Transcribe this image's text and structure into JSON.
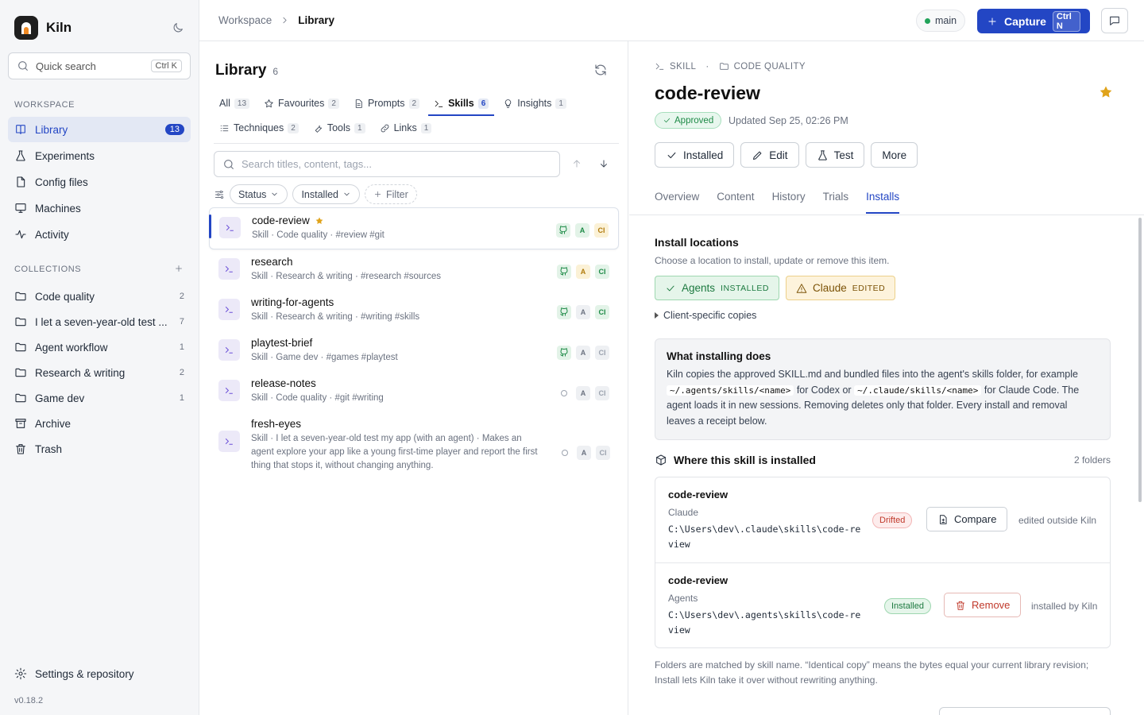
{
  "app": {
    "name": "Kiln",
    "version": "v0.18.2"
  },
  "search": {
    "label": "Quick search",
    "shortcut": "Ctrl K"
  },
  "sidebar": {
    "workspace_heading": "WORKSPACE",
    "nav": [
      {
        "label": "Library",
        "count": "13",
        "icon": "library-icon"
      },
      {
        "label": "Experiments",
        "count": "",
        "icon": "flask-icon"
      },
      {
        "label": "Config files",
        "count": "",
        "icon": "file-icon"
      },
      {
        "label": "Machines",
        "count": "",
        "icon": "monitor-icon"
      },
      {
        "label": "Activity",
        "count": "",
        "icon": "activity-icon"
      }
    ],
    "collections_heading": "COLLECTIONS",
    "collections": [
      {
        "label": "Code quality",
        "count": "2"
      },
      {
        "label": "I let a seven-year-old test ...",
        "count": "7"
      },
      {
        "label": "Agent workflow",
        "count": "1"
      },
      {
        "label": "Research & writing",
        "count": "2"
      },
      {
        "label": "Game dev",
        "count": "1"
      },
      {
        "label": "Archive",
        "count": ""
      },
      {
        "label": "Trash",
        "count": ""
      }
    ],
    "settings_label": "Settings & repository"
  },
  "topbar": {
    "breadcrumb": [
      "Workspace",
      "Library"
    ],
    "branch": "main",
    "capture_label": "Capture",
    "capture_shortcut": "Ctrl N"
  },
  "library": {
    "title": "Library",
    "count": "6",
    "tabs_row1": [
      {
        "label": "All",
        "count": "13"
      },
      {
        "label": "Favourites",
        "count": "2"
      },
      {
        "label": "Prompts",
        "count": "2"
      },
      {
        "label": "Skills",
        "count": "6"
      },
      {
        "label": "Insights",
        "count": "1"
      }
    ],
    "tabs_row2": [
      {
        "label": "Techniques",
        "count": "2"
      },
      {
        "label": "Tools",
        "count": "1"
      },
      {
        "label": "Links",
        "count": "1"
      }
    ],
    "search_placeholder": "Search titles, content, tags...",
    "filters": {
      "status": "Status",
      "installed": "Installed",
      "add": "Filter"
    },
    "items": [
      {
        "title": "code-review",
        "meta": "Skill · Code quality · #review #git",
        "starred": true
      },
      {
        "title": "research",
        "meta": "Skill · Research & writing · #research #sources"
      },
      {
        "title": "writing-for-agents",
        "meta": "Skill · Research & writing · #writing #skills"
      },
      {
        "title": "playtest-brief",
        "meta": "Skill · Game dev · #games #playtest"
      },
      {
        "title": "release-notes",
        "meta": "Skill · Code quality · #git #writing"
      },
      {
        "title": "fresh-eyes",
        "meta": "Skill · I let a seven-year-old test my app (with an agent) · Makes an agent explore your app like a young first-time player and report the first thing that stops it, without changing anything."
      }
    ],
    "badge_a": "A",
    "badge_ci": "CI"
  },
  "detail": {
    "kind": "SKILL",
    "collection": "CODE QUALITY",
    "title": "code-review",
    "status": "Approved",
    "updated": "Updated Sep 25, 02:26 PM",
    "actions": {
      "installed": "Installed",
      "edit": "Edit",
      "test": "Test",
      "more": "More"
    },
    "tabs": [
      "Overview",
      "Content",
      "History",
      "Trials",
      "Installs"
    ],
    "install_heading": "Install locations",
    "install_sub": "Choose a location to install, update or remove this item.",
    "locations": [
      {
        "name": "Agents",
        "state": "INSTALLED"
      },
      {
        "name": "Claude",
        "state": "EDITED"
      }
    ],
    "client_copies": "Client-specific copies",
    "info": {
      "title": "What installing does",
      "p1": "Kiln copies the approved SKILL.md and bundled files into the agent's skills folder, for example",
      "code1": "~/.agents/skills/<name>",
      "p2": "for Codex or",
      "code2": "~/.claude/skills/<name>",
      "p3": "for Claude Code. The agent loads it in new sessions. Removing deletes only that folder. Every install and removal leaves a receipt below."
    },
    "where_title": "Where this skill is installed",
    "where_count": "2 folders",
    "installs": [
      {
        "name": "code-review",
        "client": "Claude",
        "path": "C:\\Users\\dev\\.claude\\skills\\code-review",
        "status": "Drifted",
        "action": "Compare",
        "note": "edited outside Kiln"
      },
      {
        "name": "code-review",
        "client": "Agents",
        "path": "C:\\Users\\dev\\.agents\\skills\\code-review",
        "status": "Installed",
        "action": "Remove",
        "note": "installed by Kiln"
      }
    ],
    "footnote": "Folders are matched by skill name. “Identical copy” means the bytes equal your current library revision; Install lets Kiln take it over without rewriting anything."
  },
  "colors": {
    "accent": "#2346c4",
    "success": "#1d8a46",
    "warning": "#b07a0c",
    "danger": "#c0392b",
    "star": "#e0a31a"
  }
}
